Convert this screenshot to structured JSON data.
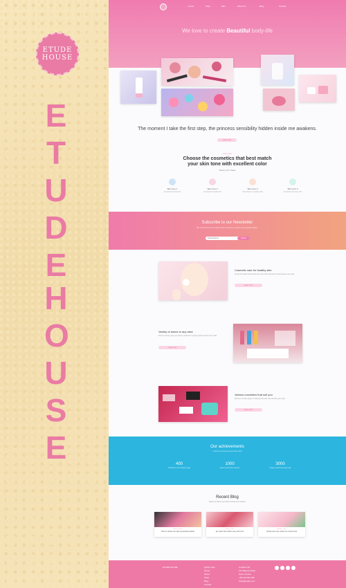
{
  "brand": {
    "logo_line1": "ETUDE",
    "logo_line2": "HOUSE",
    "vertical_1": [
      "E",
      "T",
      "U",
      "D",
      "E"
    ],
    "vertical_2": [
      "H",
      "O",
      "U",
      "S",
      "E"
    ]
  },
  "nav": {
    "items": [
      "Home",
      "Shop",
      "Skin",
      "About Us",
      "Blog",
      "Contact"
    ]
  },
  "hero": {
    "title_pre": "We love to create ",
    "title_bold": "Beautiful",
    "title_post": " body-life"
  },
  "tagline": {
    "text": "The moment I take the first step, the princess sensibility hidden inside me awakens.",
    "button": "Learn more"
  },
  "choose": {
    "eyebrow": "Skin Care",
    "title": "Choose the cosmetics that best match your skin tone with excellent color",
    "sub": "Select your shade",
    "tones": [
      {
        "name": "Skin tone 1",
        "desc": "Cosmetics for fair skin",
        "color": "#cfe3f7"
      },
      {
        "name": "Skin tone 2",
        "desc": "Cosmetics for light skin",
        "color": "#f7d7e6"
      },
      {
        "name": "Skin tone 3",
        "desc": "Cosmetics for medium skin",
        "color": "#fbe1d4"
      },
      {
        "name": "Skin tone 4",
        "desc": "Cosmetics for deep skin",
        "color": "#d4f3ec"
      }
    ]
  },
  "newsletter": {
    "title": "Subscribe to our Newsletter",
    "desc": "Be the first to know about new products, events and special offers.",
    "placeholder": "Email Address",
    "button": "Submit"
  },
  "features": [
    {
      "title": "Cosmetic care for healthy skin",
      "desc": "Gentle formulas that nourish your skin and bring out its natural glow every day.",
      "button": "Learn more"
    },
    {
      "title": "Variety of stores in any area",
      "desc": "Find our stores near you and try products in person with the help of our staff.",
      "button": "Learn more"
    },
    {
      "title": "Various cosmetics that suit you",
      "desc": "Discover a wide range of makeup and skin care that fits your style.",
      "button": "Learn more"
    }
  ],
  "achievements": {
    "title": "Our achievements",
    "desc": "Loved by customers around the world",
    "stats": [
      {
        "number": "400",
        "label": "Products in our beauty range"
      },
      {
        "number": "1000",
        "label": "Stores across the country"
      },
      {
        "number": "3000",
        "label": "Happy customers every day"
      }
    ]
  },
  "blog": {
    "title": "Recent Blog",
    "sub": "Read our latest news about beauty and makeup",
    "cards": [
      {
        "meta": "Beauty · News",
        "title": "How to choose the right eyeshadow palette"
      },
      {
        "meta": "Beauty · Tips",
        "title": "Lip colors that match every skin tone"
      },
      {
        "meta": "Beauty · Care",
        "title": "Simple skin care routine for a fresh look"
      }
    ]
  },
  "footer": {
    "col1_title": "ETUDE HOUSE",
    "col2_title": "Quick Links",
    "col3_title": "Contact Info",
    "links": [
      "Home",
      "About",
      "Shop",
      "Blog",
      "Contact"
    ],
    "contact": [
      "123 Beauty Street",
      "Seoul, Korea",
      "+82 123 456 789",
      "hello@etude.com"
    ]
  },
  "colors": {
    "pink": "#ee79a7",
    "blue": "#2bb5df",
    "peach": "#f2a37f",
    "sand": "#f3deae"
  }
}
